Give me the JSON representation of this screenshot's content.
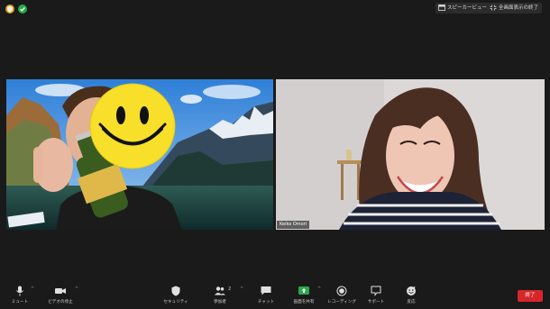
{
  "top": {
    "speaker_view": "スピーカービュー",
    "exit_fullscreen": "全画面表示の終了"
  },
  "participants": [
    {
      "name": ""
    },
    {
      "name": "Keiko Omori"
    }
  ],
  "toolbar": {
    "mute": "ミュート",
    "stop_video": "ビデオの停止",
    "security": "セキュリティ",
    "participants": "参加者",
    "participants_count": "2",
    "chat": "チャット",
    "share_screen": "画面を共有",
    "record": "レコーディング",
    "support": "サポート",
    "reactions": "反応",
    "end": "終了"
  },
  "colors": {
    "background": "#1a1a1a",
    "share_green": "#2ba84a",
    "end_red": "#d7262a"
  }
}
